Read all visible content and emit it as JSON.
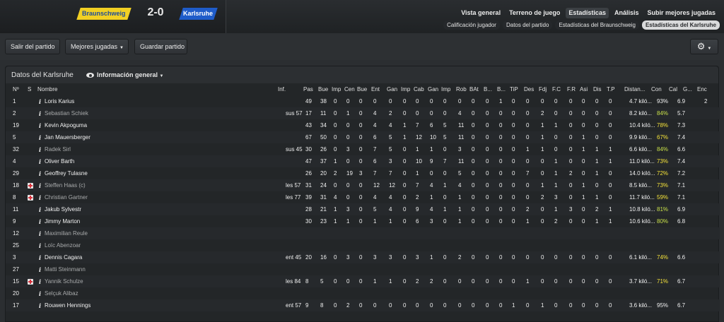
{
  "match": {
    "home_team": "Braunschweig",
    "score": "2-0",
    "away_team": "Karlsruhe",
    "home_color": "#f2d023",
    "away_color": "#1f5cc9"
  },
  "main_nav": [
    "Vista general",
    "Terreno de juego",
    "Estadísticas",
    "Análisis",
    "Subir mejores jugadas"
  ],
  "main_nav_active": "Estadísticas",
  "sub_nav": [
    "Calificación jugador",
    "Datos del partido",
    "Estadísticas del Braunschweig",
    "Estadísticas del Karlsruhe"
  ],
  "sub_nav_active": "Estadísticas del Karlsruhe",
  "toolbar": {
    "exit_label": "Salir del partido",
    "best_label": "Mejores jugadas",
    "save_label": "Guardar partido",
    "gear_icon": "gear-icon"
  },
  "panel": {
    "title": "Datos del Karlsruhe",
    "view_label": "Información general"
  },
  "columns": [
    "Nº",
    "S",
    "Nombre",
    "Inf.",
    "Pas",
    "Bue",
    "Imp",
    "Cen",
    "Bue",
    "Ent",
    "Gan",
    "Imp",
    "Cab",
    "Gan",
    "Imp",
    "Rob",
    "BAt",
    "B...",
    "B...",
    "TiP",
    "Des",
    "Fdj",
    "F.C",
    "F.R",
    "Asi",
    "Dis",
    "T.P",
    "Distan...",
    "Con",
    "Cal",
    "G...",
    "Enc"
  ],
  "players": [
    {
      "num": "1",
      "inj": false,
      "name": "Loris Karius",
      "sub": false,
      "inf": "",
      "stats": [
        "49",
        "38",
        "0",
        "0",
        "0",
        "0",
        "0",
        "0",
        "0",
        "0",
        "0",
        "0",
        "0",
        "0",
        "1",
        "0",
        "0",
        "0",
        "0",
        "0",
        "0",
        "0",
        "0"
      ],
      "dist": "4.7 kiló...",
      "con": "93%",
      "con_color": "#f0f0f0",
      "cal": "6.9",
      "g": "",
      "enc": "2"
    },
    {
      "num": "2",
      "inj": false,
      "name": "Sebastian Schiek",
      "sub": true,
      "inf": "sus 57",
      "stats": [
        "17",
        "11",
        "0",
        "1",
        "0",
        "4",
        "2",
        "0",
        "0",
        "0",
        "0",
        "4",
        "0",
        "0",
        "0",
        "0",
        "0",
        "2",
        "0",
        "0",
        "0",
        "0",
        "0"
      ],
      "dist": "8.2 kiló...",
      "con": "84%",
      "con_color": "#c8e04a",
      "cal": "5.7",
      "g": "",
      "enc": ""
    },
    {
      "num": "19",
      "inj": false,
      "name": "Kevin Akpoguma",
      "sub": false,
      "inf": "",
      "stats": [
        "43",
        "34",
        "0",
        "0",
        "0",
        "4",
        "4",
        "1",
        "7",
        "6",
        "5",
        "11",
        "0",
        "0",
        "0",
        "0",
        "0",
        "1",
        "1",
        "0",
        "0",
        "0",
        "0"
      ],
      "dist": "10.4 kiló...",
      "con": "78%",
      "con_color": "#f4e23a",
      "cal": "7.3",
      "g": "",
      "enc": ""
    },
    {
      "num": "5",
      "inj": false,
      "name": "Jan Mauersberger",
      "sub": false,
      "inf": "",
      "stats": [
        "67",
        "50",
        "0",
        "0",
        "0",
        "6",
        "5",
        "1",
        "12",
        "10",
        "5",
        "11",
        "0",
        "0",
        "0",
        "0",
        "0",
        "1",
        "0",
        "0",
        "1",
        "0",
        "0"
      ],
      "dist": "9.9 kiló...",
      "con": "67%",
      "con_color": "#f4e23a",
      "cal": "7.4",
      "g": "",
      "enc": ""
    },
    {
      "num": "32",
      "inj": false,
      "name": "Radek Sirl",
      "sub": true,
      "inf": "sus 45",
      "stats": [
        "30",
        "26",
        "0",
        "3",
        "0",
        "7",
        "5",
        "0",
        "1",
        "1",
        "0",
        "3",
        "0",
        "0",
        "0",
        "0",
        "1",
        "1",
        "0",
        "0",
        "1",
        "1",
        "1"
      ],
      "dist": "6.6 kiló...",
      "con": "84%",
      "con_color": "#c8e04a",
      "cal": "6.6",
      "g": "",
      "enc": ""
    },
    {
      "num": "4",
      "inj": false,
      "name": "Oliver Barth",
      "sub": false,
      "inf": "",
      "stats": [
        "47",
        "37",
        "1",
        "0",
        "0",
        "6",
        "3",
        "0",
        "10",
        "9",
        "7",
        "11",
        "0",
        "0",
        "0",
        "0",
        "0",
        "0",
        "1",
        "0",
        "0",
        "1",
        "1"
      ],
      "dist": "11.0 kiló...",
      "con": "73%",
      "con_color": "#f4e23a",
      "cal": "7.4",
      "g": "",
      "enc": ""
    },
    {
      "num": "29",
      "inj": false,
      "name": "Geoffrey Tulasne",
      "sub": false,
      "inf": "",
      "stats": [
        "26",
        "20",
        "2",
        "19",
        "3",
        "7",
        "7",
        "0",
        "1",
        "0",
        "0",
        "5",
        "0",
        "0",
        "0",
        "0",
        "7",
        "0",
        "1",
        "2",
        "0",
        "1",
        "0"
      ],
      "dist": "14.0 kiló...",
      "con": "72%",
      "con_color": "#f4e23a",
      "cal": "7.2",
      "g": "",
      "enc": ""
    },
    {
      "num": "18",
      "inj": true,
      "name": "Steffen Haas (c)",
      "sub": true,
      "inf": "les 57",
      "stats": [
        "31",
        "24",
        "0",
        "0",
        "0",
        "12",
        "12",
        "0",
        "7",
        "4",
        "1",
        "4",
        "0",
        "0",
        "0",
        "0",
        "0",
        "1",
        "1",
        "0",
        "1",
        "0",
        "0"
      ],
      "dist": "8.5 kiló...",
      "con": "73%",
      "con_color": "#f4e23a",
      "cal": "7.1",
      "g": "",
      "enc": ""
    },
    {
      "num": "8",
      "inj": true,
      "name": "Christian Gartner",
      "sub": true,
      "inf": "les 77",
      "stats": [
        "39",
        "31",
        "4",
        "0",
        "0",
        "4",
        "4",
        "0",
        "2",
        "1",
        "0",
        "1",
        "0",
        "0",
        "0",
        "0",
        "0",
        "2",
        "3",
        "0",
        "1",
        "1",
        "0"
      ],
      "dist": "11.7 kiló...",
      "con": "59%",
      "con_color": "#f4e23a",
      "cal": "7.1",
      "g": "",
      "enc": ""
    },
    {
      "num": "11",
      "inj": false,
      "name": "Jakub Sylvestr",
      "sub": false,
      "inf": "",
      "stats": [
        "28",
        "21",
        "1",
        "3",
        "0",
        "5",
        "4",
        "0",
        "9",
        "4",
        "1",
        "1",
        "0",
        "0",
        "0",
        "0",
        "2",
        "0",
        "1",
        "3",
        "0",
        "2",
        "1"
      ],
      "dist": "10.8 kiló...",
      "con": "81%",
      "con_color": "#c8e04a",
      "cal": "6.9",
      "g": "",
      "enc": ""
    },
    {
      "num": "9",
      "inj": false,
      "name": "Jimmy Marton",
      "sub": false,
      "inf": "",
      "stats": [
        "30",
        "23",
        "1",
        "1",
        "0",
        "1",
        "1",
        "0",
        "6",
        "3",
        "0",
        "1",
        "0",
        "0",
        "0",
        "0",
        "1",
        "0",
        "2",
        "0",
        "0",
        "1",
        "1"
      ],
      "dist": "10.6 kiló...",
      "con": "80%",
      "con_color": "#c8e04a",
      "cal": "6.8",
      "g": "",
      "enc": ""
    },
    {
      "num": "12",
      "inj": false,
      "name": "Maximilian Reule",
      "sub": true,
      "inf": "",
      "stats": [],
      "dist": "",
      "con": "",
      "con_color": "#f0f0f0",
      "cal": "",
      "g": "",
      "enc": ""
    },
    {
      "num": "25",
      "inj": false,
      "name": "Loïc Abenzoar",
      "sub": true,
      "inf": "",
      "stats": [],
      "dist": "",
      "con": "",
      "con_color": "#f0f0f0",
      "cal": "",
      "g": "",
      "enc": ""
    },
    {
      "num": "3",
      "inj": false,
      "name": "Dennis Cagara",
      "sub": false,
      "inf": "ent 45",
      "stats": [
        "20",
        "16",
        "0",
        "3",
        "0",
        "3",
        "3",
        "0",
        "3",
        "1",
        "0",
        "2",
        "0",
        "0",
        "0",
        "0",
        "0",
        "0",
        "0",
        "0",
        "0",
        "0",
        "0"
      ],
      "dist": "6.1 kiló...",
      "con": "74%",
      "con_color": "#f4e23a",
      "cal": "6.6",
      "g": "",
      "enc": ""
    },
    {
      "num": "27",
      "inj": false,
      "name": "Matti Steinmann",
      "sub": true,
      "inf": "",
      "stats": [],
      "dist": "",
      "con": "",
      "con_color": "#f0f0f0",
      "cal": "",
      "g": "",
      "enc": ""
    },
    {
      "num": "15",
      "inj": true,
      "name": "Yannik Schulze",
      "sub": true,
      "inf": "les 84",
      "stats": [
        "8",
        "5",
        "0",
        "0",
        "0",
        "1",
        "1",
        "0",
        "2",
        "2",
        "0",
        "0",
        "0",
        "0",
        "0",
        "0",
        "1",
        "0",
        "0",
        "0",
        "0",
        "0",
        "0"
      ],
      "dist": "3.7 kiló...",
      "con": "71%",
      "con_color": "#f4e23a",
      "cal": "6.7",
      "g": "",
      "enc": ""
    },
    {
      "num": "20",
      "inj": false,
      "name": "Selçuk Alibaz",
      "sub": true,
      "inf": "",
      "stats": [],
      "dist": "",
      "con": "",
      "con_color": "#f0f0f0",
      "cal": "",
      "g": "",
      "enc": ""
    },
    {
      "num": "17",
      "inj": false,
      "name": "Rouwen Hennings",
      "sub": false,
      "inf": "ent 57",
      "stats": [
        "9",
        "8",
        "0",
        "2",
        "0",
        "0",
        "0",
        "0",
        "0",
        "0",
        "0",
        "0",
        "0",
        "0",
        "0",
        "1",
        "0",
        "1",
        "0",
        "0",
        "0",
        "0",
        "0"
      ],
      "dist": "3.6 kiló...",
      "con": "95%",
      "con_color": "#f0f0f0",
      "cal": "6.7",
      "g": "",
      "enc": ""
    }
  ]
}
